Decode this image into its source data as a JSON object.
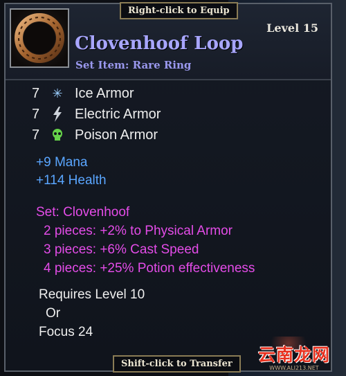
{
  "tooltip": {
    "equip_hint": "Right-click to Equip",
    "transfer_hint": "Shift-click to Transfer",
    "level": "Level 15",
    "item_name": "Clovenhoof Loop",
    "item_type": "Set Item: Rare Ring",
    "armor": [
      {
        "value": "7",
        "label": "Ice Armor",
        "icon": "snowflake-icon",
        "color": "#9ccfff"
      },
      {
        "value": "7",
        "label": "Electric Armor",
        "icon": "lightning-icon",
        "color": "#cfd4dc"
      },
      {
        "value": "7",
        "label": "Poison Armor",
        "icon": "poison-skull-icon",
        "color": "#66d24a"
      }
    ],
    "stats": [
      "+9 Mana",
      "+114 Health"
    ],
    "set_bonuses": {
      "title": "Set: Clovenhoof",
      "lines": [
        "2 pieces: +2% to Physical Armor",
        "3 pieces: +6% Cast Speed",
        "4 pieces: +25% Potion effectiveness"
      ]
    },
    "requirements": [
      "Requires Level 10",
      "Or",
      "Focus 24"
    ]
  },
  "watermark": {
    "text": "云南龙网",
    "url": "WWW.ALI213.NET"
  },
  "colors": {
    "item_name": "#a8a6ff",
    "magic_stat": "#5aa6ff",
    "set_text": "#e44ce8",
    "requirement": "#efefef"
  }
}
